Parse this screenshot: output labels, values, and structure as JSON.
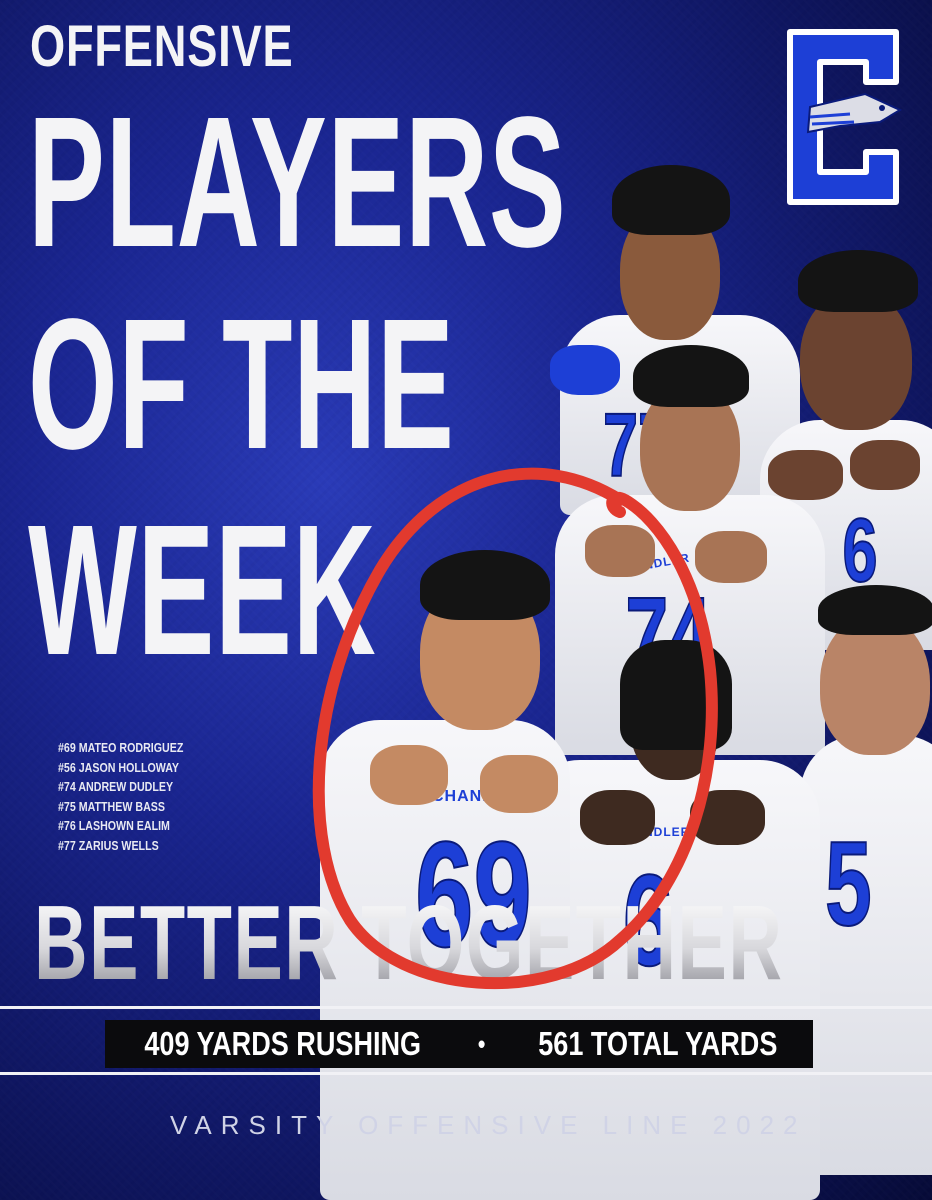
{
  "headline": {
    "line1": "OFFENSIVE",
    "line2": "PLAYERS",
    "line3": "OF THE",
    "line4": "WEEK"
  },
  "roster": [
    "#69 MATEO RODRIGUEZ",
    "#56 JASON HOLLOWAY",
    "#74 ANDREW DUDLEY",
    "#75 MATTHEW BASS",
    "#76 LASHOWN EALIM",
    "#77 ZARIUS WELLS"
  ],
  "slogan": "BETTER TOGETHER",
  "stats": {
    "rushing": "409 YARDS RUSHING",
    "separator": "•",
    "total": "561 TOTAL YARDS"
  },
  "footer": "VARSITY OFFENSIVE LINE 2022",
  "jersey_text": {
    "chandler": "CHANDLER",
    "numbers": [
      "77",
      "74",
      "69",
      "6",
      "5",
      "6"
    ]
  },
  "logo_letter": "C",
  "colors": {
    "background": "#1a2590",
    "jersey_blue": "#1d3fd6",
    "highlight": "#e23a2e",
    "text": "#f4f4f6"
  },
  "icons": [
    "chandler-wolf-logo-icon",
    "red-circle-highlight-icon"
  ]
}
